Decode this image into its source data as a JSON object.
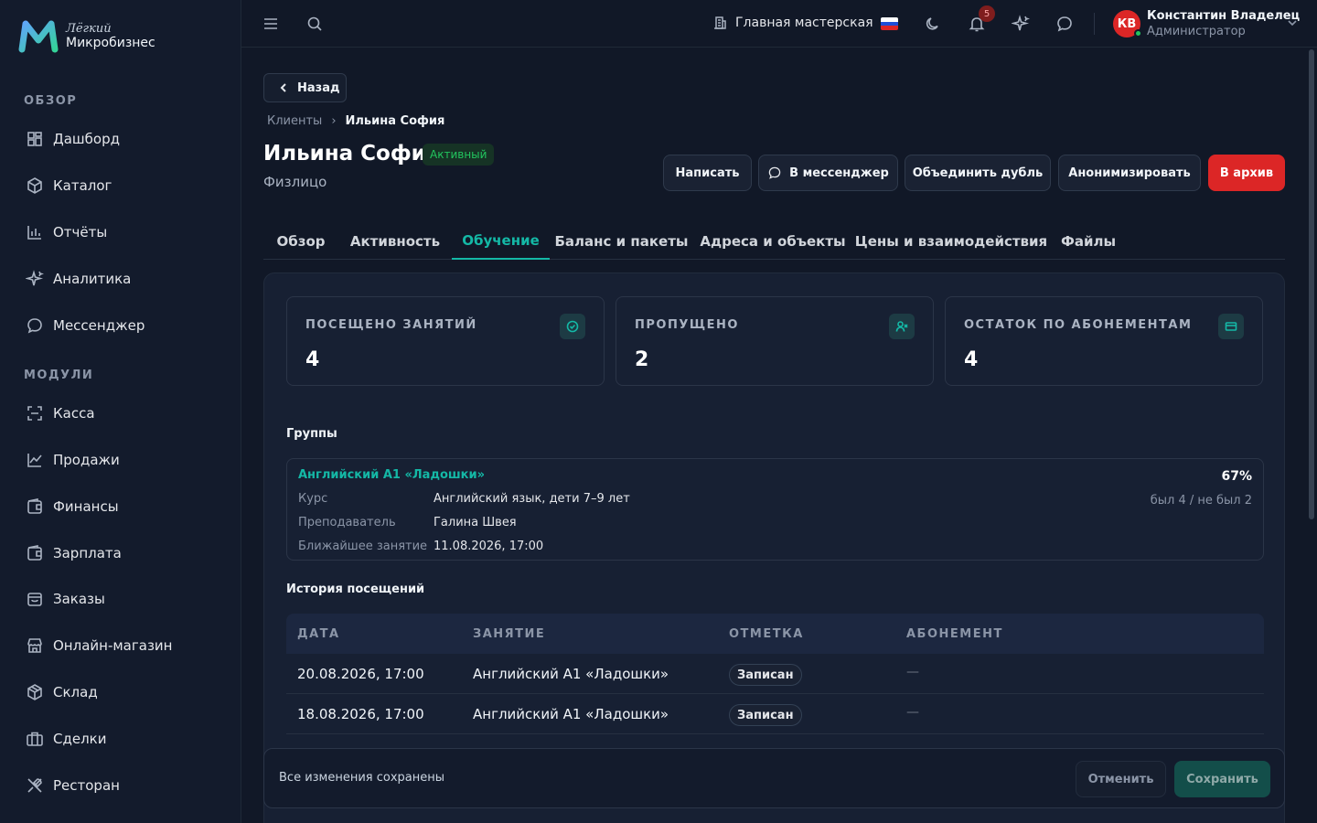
{
  "brand": {
    "line1": "Лёгкий",
    "line2": "Микробизнес",
    "colors": {
      "accent": "#14b8a6",
      "danger": "#dc2626",
      "success": "#22c55e"
    }
  },
  "sidebar": {
    "sections": [
      {
        "label": "ОБЗОР"
      },
      {
        "label": "МОДУЛИ"
      }
    ],
    "items": [
      {
        "label": "Дашборд",
        "icon": "dashboard-icon"
      },
      {
        "label": "Каталог",
        "icon": "box-icon"
      },
      {
        "label": "Отчёты",
        "icon": "bar-chart-icon"
      },
      {
        "label": "Аналитика",
        "icon": "sparkles-icon"
      },
      {
        "label": "Мессенджер",
        "icon": "chat-icon"
      },
      {
        "label": "Касса",
        "icon": "scan-icon"
      },
      {
        "label": "Продажи",
        "icon": "line-chart-icon"
      },
      {
        "label": "Финансы",
        "icon": "wallet-icon"
      },
      {
        "label": "Зарплата",
        "icon": "wallet-icon"
      },
      {
        "label": "Заказы",
        "icon": "bag-icon"
      },
      {
        "label": "Онлайн-магазин",
        "icon": "store-icon"
      },
      {
        "label": "Склад",
        "icon": "package-icon"
      },
      {
        "label": "Сделки",
        "icon": "briefcase-icon"
      },
      {
        "label": "Ресторан",
        "icon": "utensils-icon"
      }
    ]
  },
  "topbar": {
    "workshop": "Главная мастерская",
    "notifications_count": "5",
    "user": {
      "initials": "КВ",
      "name": "Константин Владелец",
      "role": "Администратор"
    }
  },
  "page": {
    "back_label": "Назад",
    "breadcrumb": {
      "parent": "Клиенты",
      "current": "Ильина София"
    },
    "title": "Ильина София",
    "status": "Активный",
    "subtitle": "Физлицо",
    "actions": {
      "write": "Написать",
      "messenger": "В мессенджер",
      "merge": "Объединить дубль",
      "anonymize": "Анонимизировать",
      "archive": "В архив"
    },
    "tabs": [
      "Обзор",
      "Активность",
      "Обучение",
      "Баланс и пакеты",
      "Адреса и объекты",
      "Цены и взаимодействия",
      "Файлы"
    ],
    "active_tab": "Обучение"
  },
  "stats": [
    {
      "label": "ПОСЕЩЕНО ЗАНЯТИЙ",
      "value": "4",
      "icon": "check-circle-icon"
    },
    {
      "label": "ПРОПУЩЕНО",
      "value": "2",
      "icon": "user-x-icon"
    },
    {
      "label": "ОСТАТОК ПО АБОНЕМЕНТАМ",
      "value": "4",
      "icon": "card-icon"
    }
  ],
  "groups": {
    "title": "Группы",
    "item": {
      "name": "Английский A1 «Ладошки»",
      "course_label": "Курс",
      "course": "Английский язык, дети 7–9 лет",
      "teacher_label": "Преподаватель",
      "teacher": "Галина Швея",
      "next_label": "Ближайшее занятие",
      "next": "11.08.2026, 17:00",
      "percent": "67%",
      "attendance": "был 4 / не был 2"
    }
  },
  "history": {
    "title": "История посещений",
    "columns": [
      "ДАТА",
      "ЗАНЯТИЕ",
      "ОТМЕТКА",
      "АБОНЕМЕНТ"
    ],
    "rows": [
      {
        "date": "20.08.2026, 17:00",
        "lesson": "Английский A1 «Ладошки»",
        "mark": "Записан",
        "subscription": "—"
      },
      {
        "date": "18.08.2026, 17:00",
        "lesson": "Английский A1 «Ладошки»",
        "mark": "Записан",
        "subscription": "—"
      }
    ]
  },
  "savebar": {
    "status": "Все изменения сохранены",
    "cancel": "Отменить",
    "save": "Сохранить"
  }
}
